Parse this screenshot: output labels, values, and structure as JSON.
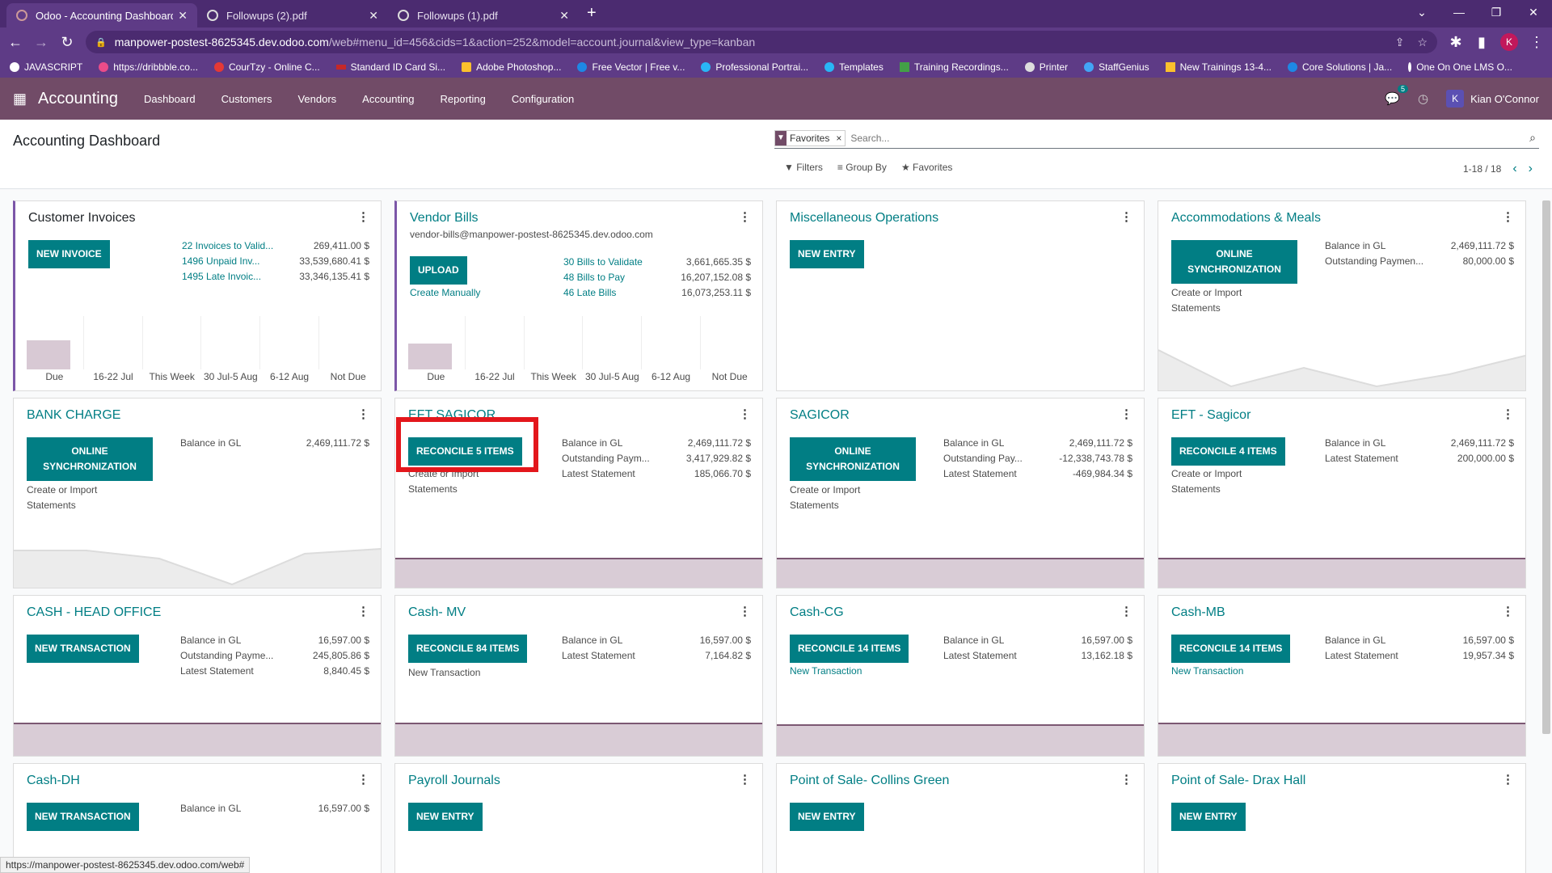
{
  "browser": {
    "tabs": [
      {
        "title": "Odoo - Accounting Dashboard",
        "active": true
      },
      {
        "title": "Followups (2).pdf",
        "active": false
      },
      {
        "title": "Followups (1).pdf",
        "active": false
      }
    ],
    "url_host": "manpower-postest-8625345.dev.odoo.com",
    "url_path": "/web#menu_id=456&cids=1&action=252&model=account.journal&view_type=kanban",
    "profile_initial": "K",
    "bookmarks": [
      "JAVASCRIPT",
      "https://dribbble.co...",
      "CourTzy - Online C...",
      "Standard ID Card Si...",
      "Adobe Photoshop...",
      "Free Vector | Free v...",
      "Professional Portrai...",
      "Templates",
      "Training Recordings...",
      "Printer",
      "StaffGenius",
      "New Trainings 13-4...",
      "Core Solutions | Ja...",
      "One On One LMS O..."
    ],
    "status_url": "https://manpower-postest-8625345.dev.odoo.com/web#"
  },
  "navbar": {
    "app": "Accounting",
    "menus": [
      "Dashboard",
      "Customers",
      "Vendors",
      "Accounting",
      "Reporting",
      "Configuration"
    ],
    "chat_count": "5",
    "user_initial": "K",
    "user_name": "Kian O'Connor"
  },
  "control": {
    "title": "Accounting Dashboard",
    "facet": "Favorites",
    "search_placeholder": "Search...",
    "filters": "Filters",
    "group_by": "Group By",
    "favorites": "Favorites",
    "pager": "1-18 / 18"
  },
  "cards": {
    "c1": {
      "title": "Customer Invoices",
      "button": "NEW INVOICE",
      "stats": [
        [
          "22 Invoices to Valid...",
          "269,411.00 $"
        ],
        [
          "1496 Unpaid Inv...",
          "33,539,680.41 $"
        ],
        [
          "1495 Late Invoic...",
          "33,346,135.41 $"
        ]
      ],
      "chart_labels": [
        "Due",
        "16-22 Jul",
        "This Week",
        "30 Jul-5 Aug",
        "6-12 Aug",
        "Not Due"
      ]
    },
    "c2": {
      "title": "Vendor Bills",
      "email": "vendor-bills@manpower-postest-8625345.dev.odoo.com",
      "button": "UPLOAD",
      "link": "Create Manually",
      "stats": [
        [
          "30 Bills to Validate",
          "3,661,665.35 $"
        ],
        [
          "48 Bills to Pay",
          "16,207,152.08 $"
        ],
        [
          "46 Late Bills",
          "16,073,253.11 $"
        ]
      ],
      "chart_labels": [
        "Due",
        "16-22 Jul",
        "This Week",
        "30 Jul-5 Aug",
        "6-12 Aug",
        "Not Due"
      ]
    },
    "c3": {
      "title": "Miscellaneous Operations",
      "button": "NEW ENTRY"
    },
    "c4": {
      "title": "Accommodations & Meals",
      "button": "ONLINE SYNCHRONIZATION",
      "link": "Create or Import Statements",
      "stats": [
        [
          "Balance in GL",
          "2,469,111.72 $"
        ],
        [
          "Outstanding Paymen...",
          "80,000.00 $"
        ]
      ]
    },
    "c5": {
      "title": "BANK CHARGE",
      "button": "ONLINE SYNCHRONIZATION",
      "link": "Create or Import Statements",
      "stats": [
        [
          "Balance in GL",
          "2,469,111.72 $"
        ]
      ]
    },
    "c6": {
      "title": "EFT SAGICOR",
      "button": "RECONCILE 5 ITEMS",
      "link": "Create or Import Statements",
      "stats": [
        [
          "Balance in GL",
          "2,469,111.72 $"
        ],
        [
          "Outstanding Paym...",
          "3,417,929.82 $"
        ],
        [
          "Latest Statement",
          "185,066.70 $"
        ]
      ]
    },
    "c7": {
      "title": "SAGICOR",
      "button": "ONLINE SYNCHRONIZATION",
      "link": "Create or Import Statements",
      "stats": [
        [
          "Balance in GL",
          "2,469,111.72 $"
        ],
        [
          "Outstanding Pay...",
          "-12,338,743.78 $"
        ],
        [
          "Latest Statement",
          "-469,984.34 $"
        ]
      ]
    },
    "c8": {
      "title": "EFT - Sagicor",
      "button": "RECONCILE 4 ITEMS",
      "link": "Create or Import Statements",
      "stats": [
        [
          "Balance in GL",
          "2,469,111.72 $"
        ],
        [
          "Latest Statement",
          "200,000.00 $"
        ]
      ]
    },
    "c9": {
      "title": "CASH - HEAD OFFICE",
      "button": "NEW TRANSACTION",
      "stats": [
        [
          "Balance in GL",
          "16,597.00 $"
        ],
        [
          "Outstanding Payme...",
          "245,805.86 $"
        ],
        [
          "Latest Statement",
          "8,840.45 $"
        ]
      ]
    },
    "c10": {
      "title": "Cash- MV",
      "button": "RECONCILE 84 ITEMS",
      "link": "New Transaction",
      "stats": [
        [
          "Balance in GL",
          "16,597.00 $"
        ],
        [
          "Latest Statement",
          "7,164.82 $"
        ]
      ]
    },
    "c11": {
      "title": "Cash-CG",
      "button": "RECONCILE 14 ITEMS",
      "link": "New Transaction",
      "stats": [
        [
          "Balance in GL",
          "16,597.00 $"
        ],
        [
          "Latest Statement",
          "13,162.18 $"
        ]
      ]
    },
    "c12": {
      "title": "Cash-MB",
      "button": "RECONCILE 14 ITEMS",
      "link": "New Transaction",
      "stats": [
        [
          "Balance in GL",
          "16,597.00 $"
        ],
        [
          "Latest Statement",
          "19,957.34 $"
        ]
      ]
    },
    "c13": {
      "title": "Cash-DH",
      "button": "NEW TRANSACTION",
      "stats": [
        [
          "Balance in GL",
          "16,597.00 $"
        ]
      ]
    },
    "c14": {
      "title": "Payroll Journals",
      "button": "NEW ENTRY"
    },
    "c15": {
      "title": "Point of Sale- Collins Green",
      "button": "NEW ENTRY"
    },
    "c16": {
      "title": "Point of Sale- Drax Hall",
      "button": "NEW ENTRY"
    }
  },
  "colors": {
    "brand": "#714b67",
    "accent": "#017e84",
    "highlight": "#e3171c"
  }
}
